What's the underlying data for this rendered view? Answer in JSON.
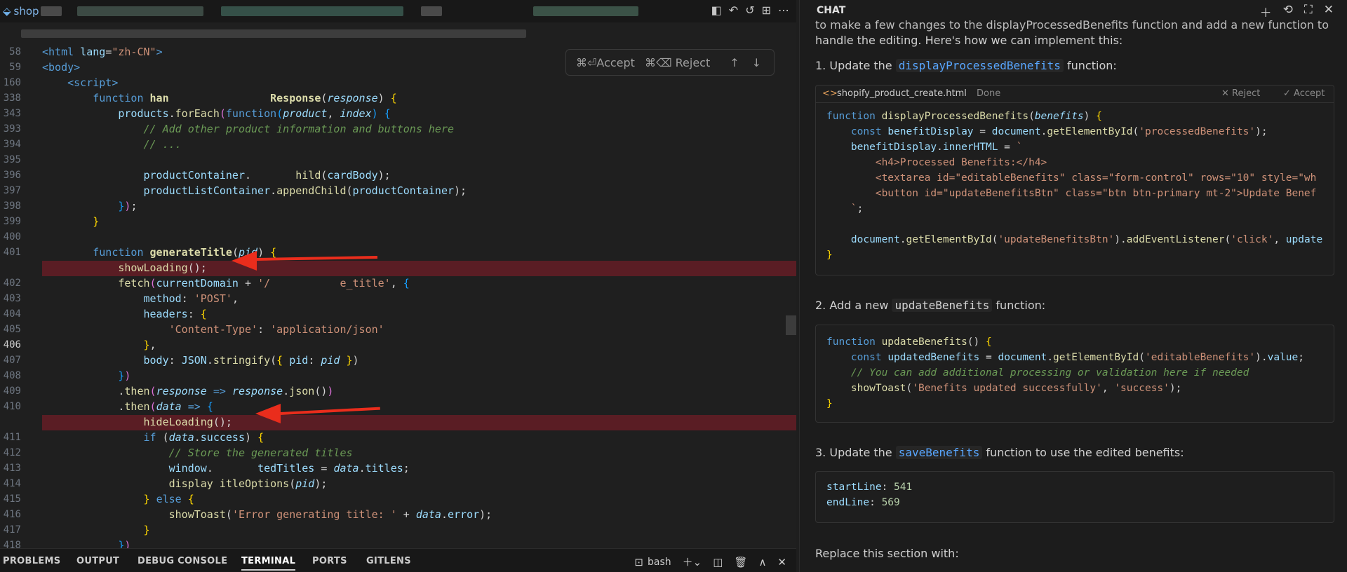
{
  "editor": {
    "tab_title": "shop",
    "inline_diff": {
      "accept_label": "⌘⏎Accept",
      "reject_label": "⌘⌫ Reject"
    },
    "lines": [
      {
        "n": "58",
        "html": "<span class='tag'>&lt;html</span> <span class='attr'>lang</span>=<span class='str'>\"zh-CN\"</span><span class='tag'>&gt;</span>"
      },
      {
        "n": "59",
        "html": "<span class='tag'>&lt;body&gt;</span>"
      },
      {
        "n": "160",
        "html": "    <span class='tag'>&lt;script&gt;</span>"
      },
      {
        "n": "338",
        "html": "        <span class='kw'>function</span> <span class='fn'>han</span>                <span class='fn'>Response</span>(<span class='par'>response</span>) <span class='br'>{</span>"
      },
      {
        "n": "343",
        "html": "            <span class='prop'>products</span>.<span class='fnc'>forEach</span><span class='br2'>(</span><span class='kw'>function</span><span class='br3'>(</span><span class='par'>product</span>, <span class='par'>index</span><span class='br3'>)</span> <span class='br3'>{</span>"
      },
      {
        "n": "393",
        "html": "                <span class='cm'>// Add other product information and buttons here</span>"
      },
      {
        "n": "394",
        "html": "                <span class='cm'>// ...</span>"
      },
      {
        "n": "395",
        "html": ""
      },
      {
        "n": "396",
        "html": "                <span class='prop'>productContainer</span>.       <span class='fnc'>hild</span>(<span class='prop'>cardBody</span>);"
      },
      {
        "n": "397",
        "html": "                <span class='prop'>productListContainer</span>.<span class='fnc'>appendChild</span>(<span class='prop'>productContainer</span>);"
      },
      {
        "n": "398",
        "html": "            <span class='br3'>}</span><span class='br2'>)</span>;"
      },
      {
        "n": "399",
        "html": "        <span class='br'>}</span>"
      },
      {
        "n": "400",
        "html": ""
      },
      {
        "n": "401",
        "html": "        <span class='kw'>function</span> <span class='fn'>generateTitle</span>(<span class='par'>pid</span>) <span class='br'>{</span>"
      },
      {
        "n": "",
        "html": "            <span class='fnc'>showLoading</span>();",
        "hl": true
      },
      {
        "n": "402",
        "html": "            <span class='fnc'>fetch</span><span class='br2'>(</span><span class='prop'>currentDomain</span> + <span class='str'>'/           e_title'</span>, <span class='br3'>{</span>"
      },
      {
        "n": "403",
        "html": "                <span class='prop'>method</span>: <span class='str'>'POST'</span>,"
      },
      {
        "n": "404",
        "html": "                <span class='prop'>headers</span>: <span class='br'>{</span>"
      },
      {
        "n": "405",
        "html": "                    <span class='str'>'Content-Type'</span>: <span class='str'>'application/json'</span>"
      },
      {
        "n": "406",
        "html": "                <span class='br'>}</span>,",
        "cur": true
      },
      {
        "n": "407",
        "html": "                <span class='prop'>body</span>: <span class='prop'>JSON</span>.<span class='fnc'>stringify</span>(<span class='br'>{</span> <span class='prop'>pid</span>: <span class='par'>pid</span> <span class='br'>}</span>)"
      },
      {
        "n": "408",
        "html": "            <span class='br3'>}</span><span class='br2'>)</span>"
      },
      {
        "n": "409",
        "html": "            .<span class='fnc'>then</span><span class='br2'>(</span><span class='par'>response</span> <span class='kw'>=&gt;</span> <span class='par'>response</span>.<span class='fnc'>json</span>()<span class='br2'>)</span>"
      },
      {
        "n": "410",
        "html": "            .<span class='fnc'>then</span><span class='br2'>(</span><span class='par'>data</span> <span class='kw'>=&gt;</span> <span class='br3'>{</span>"
      },
      {
        "n": "",
        "html": "                <span class='fnc'>hideLoading</span>();",
        "hl": true
      },
      {
        "n": "411",
        "html": "                <span class='kw'>if</span> (<span class='par'>data</span>.<span class='prop'>success</span>) <span class='br'>{</span>"
      },
      {
        "n": "412",
        "html": "                    <span class='cm'>// Store the generated titles</span>"
      },
      {
        "n": "413",
        "html": "                    <span class='prop'>window</span>.       <span class='prop'>tedTitles</span> = <span class='par'>data</span>.<span class='prop'>titles</span>;"
      },
      {
        "n": "414",
        "html": "                    <span class='fnc'>display</span> <span class='fnc'>itleOptions</span>(<span class='par'>pid</span>);"
      },
      {
        "n": "415",
        "html": "                <span class='br'>}</span> <span class='kw'>else</span> <span class='br'>{</span>"
      },
      {
        "n": "416",
        "html": "                    <span class='fnc'>showToast</span>(<span class='str'>'Error generating title: '</span> + <span class='par'>data</span>.<span class='prop'>error</span>);"
      },
      {
        "n": "417",
        "html": "                <span class='br'>}</span>"
      },
      {
        "n": "418",
        "html": "            <span class='br3'>}</span><span class='br2'>)</span>"
      }
    ]
  },
  "panel": {
    "tabs": [
      "PROBLEMS",
      "OUTPUT",
      "DEBUG CONSOLE",
      "TERMINAL",
      "PORTS",
      "GITLENS"
    ],
    "active_tab": "TERMINAL",
    "shell_label": "bash"
  },
  "chat": {
    "title": "CHAT",
    "intro_line1": "to make a few changes to the displayProcessedBenefits function and add a new function to",
    "intro_line2": "handle the editing. Here's how we can implement this:",
    "step1_prefix": "1. Update the ",
    "step1_code": "displayProcessedBenefits",
    "step1_suffix": " function:",
    "block1": {
      "filename": "shopify_product_create.html",
      "status": "Done",
      "reject_label": "Reject",
      "accept_label": "Accept",
      "lines": [
        "<span class='kw'>function</span> <span class='fnc'>displayProcessedBenefits</span>(<span class='par'>benefits</span>) <span class='br'>{</span>",
        "    <span class='kw'>const</span> <span class='prop'>benefitDisplay</span> = <span class='prop'>document</span>.<span class='fnc'>getElementById</span>(<span class='str'>'processedBenefits'</span>);",
        "    <span class='prop'>benefitDisplay</span>.<span class='prop'>innerHTML</span> = <span class='str'>`</span>",
        "        <span class='str'>&lt;h4&gt;Processed Benefits:&lt;/h4&gt;</span>",
        "        <span class='str'>&lt;textarea id=\"editableBenefits\" class=\"form-control\" rows=\"10\" style=\"wh</span>",
        "        <span class='str'>&lt;button id=\"updateBenefitsBtn\" class=\"btn btn-primary mt-2\"&gt;Update Benef</span>",
        "    <span class='str'>`</span>;",
        "",
        "    <span class='prop'>document</span>.<span class='fnc'>getElementById</span>(<span class='str'>'updateBenefitsBtn'</span>).<span class='fnc'>addEventListener</span>(<span class='str'>'click'</span>, <span class='prop'>update</span>",
        "<span class='br'>}</span>"
      ]
    },
    "step2_prefix": "2. Add a new ",
    "step2_code": "updateBenefits",
    "step2_suffix": " function:",
    "block2": {
      "lines": [
        "<span class='kw'>function</span> <span class='fnc'>updateBenefits</span>() <span class='br'>{</span>",
        "    <span class='kw'>const</span> <span class='prop'>updatedBenefits</span> = <span class='prop'>document</span>.<span class='fnc'>getElementById</span>(<span class='str'>'editableBenefits'</span>).<span class='prop'>value</span>;",
        "    <span class='cm'>// You can add additional processing or validation here if needed</span>",
        "    <span class='fnc'>showToast</span>(<span class='str'>'Benefits updated successfully'</span>, <span class='str'>'success'</span>);",
        "<span class='br'>}</span>"
      ]
    },
    "step3_prefix": "3. Update the ",
    "step3_code": "saveBenefits",
    "step3_suffix": " function to use the edited benefits:",
    "block3": {
      "lines": [
        "<span class='prop'>startLine</span>: <span class='num'>541</span>",
        "<span class='prop'>endLine</span>: <span class='num'>569</span>"
      ]
    },
    "replace_text": "Replace this section with:"
  }
}
